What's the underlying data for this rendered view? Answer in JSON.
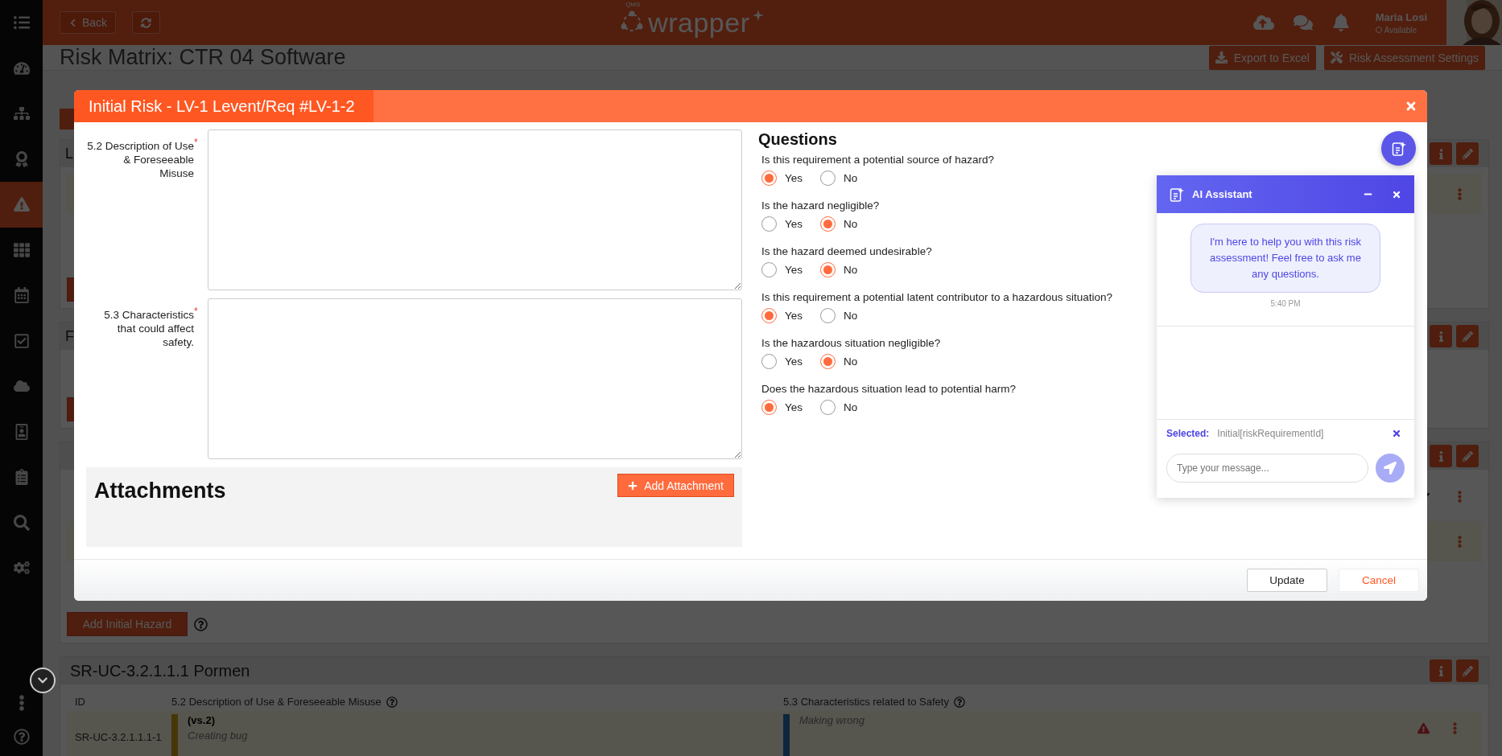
{
  "sidebar": {
    "items": [
      {
        "selected": false
      },
      {
        "selected": false
      },
      {
        "selected": false
      },
      {
        "selected": false
      },
      {
        "selected": true
      },
      {
        "selected": false
      },
      {
        "selected": false
      },
      {
        "selected": false
      },
      {
        "selected": false
      },
      {
        "selected": false
      },
      {
        "selected": false
      },
      {
        "selected": false
      },
      {
        "selected": false
      }
    ]
  },
  "top_bar": {
    "back": "Back",
    "logo": {
      "badge": "QMS",
      "name": "wrapper"
    },
    "user": {
      "name": "Maria Losi",
      "status": "Available"
    }
  },
  "page": {
    "title": "Risk Matrix: CTR 04 Software",
    "actions": [
      "Export to Excel",
      "Risk Assessment Settings"
    ]
  },
  "sections": [
    {
      "heading": "L",
      "rows": [
        {
          "highlighted": true
        }
      ]
    },
    {
      "heading": "F"
    },
    {
      "rows": [
        {
          "highlighted": false
        },
        {
          "highlighted": true
        }
      ],
      "add_button": "Add Initial Hazard"
    },
    {
      "heading": "SR-UC-3.2.1.1.1 Pormen",
      "columns": [
        "ID",
        "5.2 Description of Use & Foreseeable Misuse",
        "5.3 Characteristics related to Safety"
      ],
      "table_rows": [
        {
          "id": "SR-UC-3.2.1.1.1-1",
          "version": "(vs.2)",
          "description": "Creating bug",
          "characteristics": "Making wrong"
        }
      ]
    }
  ],
  "modal": {
    "title": "Initial Risk - LV-1 Levent/Req #LV-1-2",
    "fields": [
      {
        "label": "5.2 Description of Use & Foreseeable Misuse",
        "required_mark": "*"
      },
      {
        "label": "5.3 Characteristics that could affect safety.",
        "required_mark": "*"
      }
    ],
    "attachments": {
      "heading": "Attachments",
      "button": "Add Attachment"
    },
    "questions_heading": "Questions",
    "questions": [
      {
        "text": "Is this requirement a potential source of hazard?",
        "options": [
          {
            "label": "Yes",
            "selected": true
          },
          {
            "label": "No",
            "selected": false
          }
        ]
      },
      {
        "text": "Is the hazard negligible?",
        "options": [
          {
            "label": "Yes",
            "selected": false
          },
          {
            "label": "No",
            "selected": true
          }
        ]
      },
      {
        "text": "Is the hazard deemed undesirable?",
        "options": [
          {
            "label": "Yes",
            "selected": false
          },
          {
            "label": "No",
            "selected": true
          }
        ]
      },
      {
        "text": "Is this requirement a potential latent contributor to a hazardous situation?",
        "options": [
          {
            "label": "Yes",
            "selected": true
          },
          {
            "label": "No",
            "selected": false
          }
        ]
      },
      {
        "text": "Is the hazardous situation negligible?",
        "options": [
          {
            "label": "Yes",
            "selected": false
          },
          {
            "label": "No",
            "selected": true
          }
        ]
      },
      {
        "text": "Does the hazardous situation lead to potential harm?",
        "options": [
          {
            "label": "Yes",
            "selected": true
          },
          {
            "label": "No",
            "selected": false
          }
        ]
      }
    ],
    "buttons": [
      "Update",
      "Cancel"
    ]
  },
  "assistant": {
    "title": "AI Assistant",
    "message": "I'm here to help you with this risk assessment! Feel free to ask me any questions.",
    "time": "5:40 PM",
    "selected_label": "Selected:",
    "selected_value": "Initial[riskRequirementId]",
    "placeholder": "Type your message..."
  }
}
